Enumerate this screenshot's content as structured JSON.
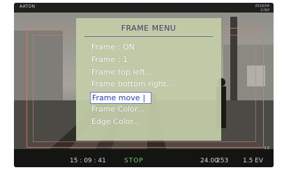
{
  "brand": "AATON",
  "top_right": [
    "2019/04",
    "2:0kf"
  ],
  "menu": {
    "title": "FRAME  MENU",
    "items": [
      {
        "label": "Frame : ON",
        "selected": false
      },
      {
        "label": "Frame : 1",
        "selected": false
      },
      {
        "label": "Frame top left...",
        "selected": false
      },
      {
        "label": "Frame bottom right...",
        "selected": false
      },
      {
        "label": "Frame move",
        "selected": true
      },
      {
        "label": "Frame Color...",
        "selected": false
      },
      {
        "label": "Edge Color...",
        "selected": false
      }
    ]
  },
  "status_bar": {
    "timecode": "15 : 09 : 41",
    "state": "STOP",
    "fps": "24.00",
    "shutter": "253",
    "ev": "1.5 EV"
  },
  "side_value": "3.0",
  "colors": {
    "menu_bg": "#c4cea8",
    "menu_text": "#ffffff",
    "title_text": "#3a3f6a",
    "selected_text": "#2a3aa8",
    "frame_line": "#e17864",
    "stop_text": "#6fd36f"
  }
}
